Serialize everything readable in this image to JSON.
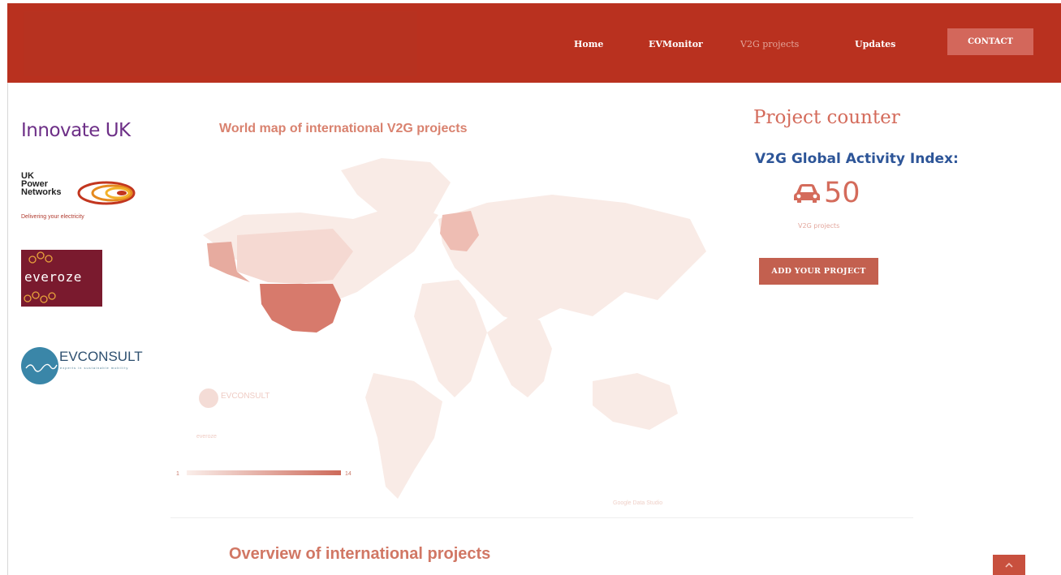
{
  "nav": {
    "items": [
      "Home",
      "EVMonitor",
      "V2G projects",
      "Updates"
    ],
    "contact_label": "CONTACT"
  },
  "sidebar_logos": {
    "innovate_uk": "Innovate UK",
    "ukpn_name": "UK Power Networks",
    "ukpn_tagline": "Delivering your electricity",
    "everoze": "everoze",
    "evconsult": "EVCONSULT",
    "evconsult_tagline": "experts in sustainable mobility"
  },
  "map": {
    "title": "World map of international V2G projects",
    "legend_min": "1",
    "legend_max": "14",
    "credit": "Google Data Studio",
    "watermark_evconsult": "EVCONSULT",
    "watermark_everoze": "everoze"
  },
  "counter": {
    "title": "Project counter",
    "index_title": "V2G Global Activity Index:",
    "value": "50",
    "label": "V2G projects",
    "add_button": "ADD YOUR PROJECT"
  },
  "overview": {
    "title": "Overview of international projects"
  },
  "icons": {
    "car": "car-icon",
    "scroll_top": "chevron-up-icon"
  },
  "colors": {
    "nav_bg": "#b9311f",
    "accent": "#d46b5b",
    "index_blue": "#2d5598"
  }
}
